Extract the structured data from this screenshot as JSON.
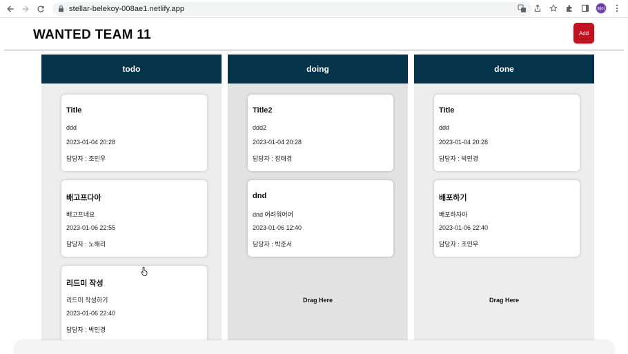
{
  "browser": {
    "url": "stellar-belekoy-008ae1.netlify.app",
    "profile_initials": "메이"
  },
  "app": {
    "title": "WANTED TEAM 11",
    "add_label": "Add",
    "accent_color": "#c1121f",
    "column_header_color": "#05334a"
  },
  "columns": [
    {
      "name": "todo",
      "drag_label": "",
      "cards": [
        {
          "title": "Title",
          "desc": "ddd",
          "date": "2023-01-04 20:28",
          "owner": "담당자 : 조민우"
        },
        {
          "title": "배고프다아",
          "desc": "배고프네요",
          "date": "2023-01-06 22:55",
          "owner": "담당자 : 노해리"
        },
        {
          "title": "리드미 작성",
          "desc": "리드미 작성하기",
          "date": "2023-01-06 22:40",
          "owner": "담당자 : 박민경"
        }
      ]
    },
    {
      "name": "doing",
      "drag_label": "Drag Here",
      "cards": [
        {
          "title": "Title2",
          "desc": "ddd2",
          "date": "2023-01-04 20:28",
          "owner": "담당자 : 장태경"
        },
        {
          "title": "dnd",
          "desc": "dnd 어려워어어",
          "date": "2023-01-06 12:40",
          "owner": "담당자 : 박준서"
        }
      ]
    },
    {
      "name": "done",
      "drag_label": "Drag Here",
      "cards": [
        {
          "title": "Title",
          "desc": "ddd",
          "date": "2023-01-04 20:28",
          "owner": "담당자 : 박민경"
        },
        {
          "title": "배포하기",
          "desc": "배포하자아",
          "date": "2023-01-06 22:40",
          "owner": "담당자 : 조민우"
        }
      ]
    }
  ]
}
